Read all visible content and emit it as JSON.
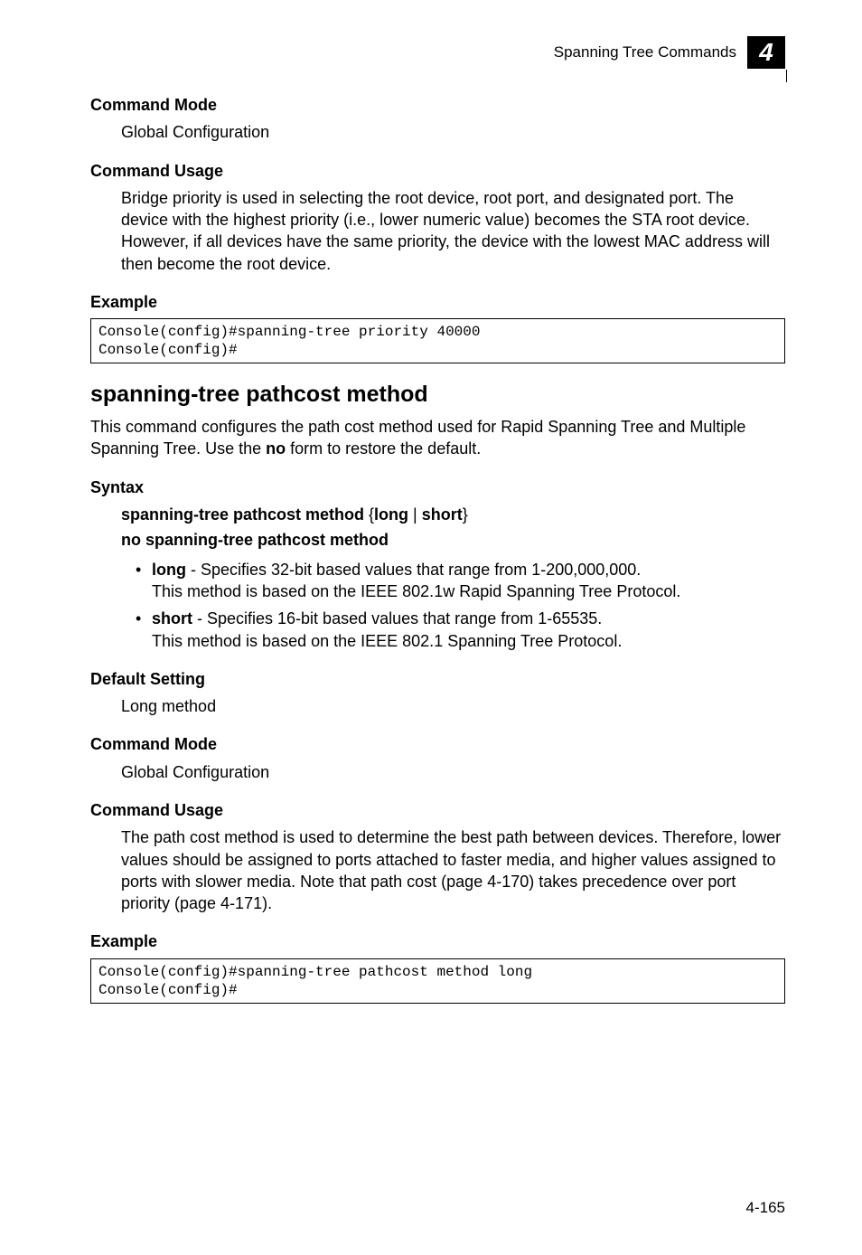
{
  "header": {
    "section": "Spanning Tree Commands",
    "chapter": "4"
  },
  "blocks": {
    "cmdmode1": {
      "title": "Command Mode",
      "body": "Global Configuration"
    },
    "cmdusage1": {
      "title": "Command Usage",
      "body": "Bridge priority is used in selecting the root device, root port, and designated port. The device with the highest priority (i.e., lower numeric value) becomes the STA root device. However, if all devices have the same priority, the device with the lowest MAC address will then become the root device."
    },
    "example1": {
      "title": "Example",
      "code": "Console(config)#spanning-tree priority 40000\nConsole(config)#"
    },
    "section": {
      "title": "spanning-tree pathcost method",
      "intro_a": "This command configures the path cost method used for Rapid Spanning Tree and Multiple Spanning Tree. Use the ",
      "intro_bold": "no",
      "intro_b": " form to restore the default."
    },
    "syntax": {
      "title": "Syntax",
      "l1a": "spanning-tree pathcost method",
      "l1b": " {",
      "l1c": "long",
      "l1d": " | ",
      "l1e": "short",
      "l1f": "}",
      "l2": "no spanning-tree pathcost method",
      "bullets": [
        {
          "kw": "long",
          "t1": " - Specifies 32-bit based values that range from 1-200,000,000.",
          "t2": "This method is based on the IEEE 802.1w Rapid Spanning Tree Protocol."
        },
        {
          "kw": "short",
          "t1": " - Specifies 16-bit based values that range from 1-65535.",
          "t2": "This method is based on the IEEE 802.1 Spanning Tree Protocol."
        }
      ]
    },
    "defset": {
      "title": "Default Setting",
      "body": "Long method"
    },
    "cmdmode2": {
      "title": "Command Mode",
      "body": "Global Configuration"
    },
    "cmdusage2": {
      "title": "Command Usage",
      "body": "The path cost method is used to determine the best path between devices. Therefore, lower values should be assigned to ports attached to faster media, and higher values assigned to ports with slower media. Note that path cost (page 4-170) takes precedence over port priority (page 4-171)."
    },
    "example2": {
      "title": "Example",
      "code": "Console(config)#spanning-tree pathcost method long\nConsole(config)#"
    }
  },
  "pagenum": "4-165"
}
